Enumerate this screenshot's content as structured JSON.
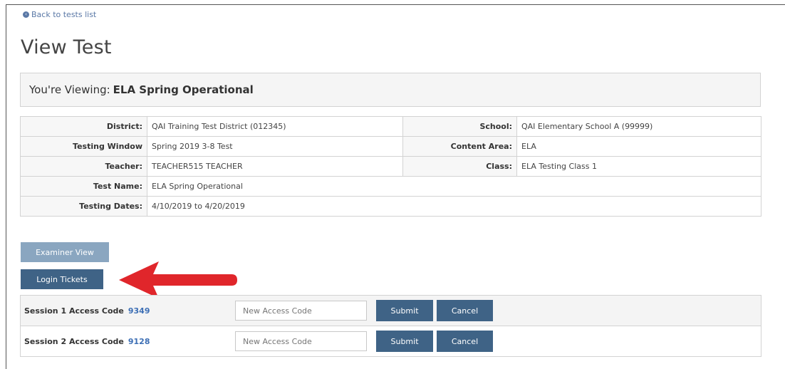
{
  "nav": {
    "back_label": "Back to tests list"
  },
  "page": {
    "title": "View Test"
  },
  "viewing": {
    "label": "You're Viewing:",
    "value": "ELA Spring Operational"
  },
  "info": {
    "district_label": "District:",
    "district_value": "QAI Training Test District (012345)",
    "school_label": "School:",
    "school_value": "QAI Elementary School A (99999)",
    "window_label": "Testing Window",
    "window_value": "Spring 2019 3-8 Test",
    "content_label": "Content Area:",
    "content_value": "ELA",
    "teacher_label": "Teacher:",
    "teacher_value": "TEACHER515 TEACHER",
    "class_label": "Class:",
    "class_value": "ELA Testing Class 1",
    "testname_label": "Test Name:",
    "testname_value": "ELA Spring Operational",
    "dates_label": "Testing Dates:",
    "dates_value": "4/10/2019 to 4/20/2019"
  },
  "buttons": {
    "examiner_view": "Examiner View",
    "login_tickets": "Login Tickets"
  },
  "sessions": [
    {
      "label": "Session 1 Access Code",
      "code": "9349",
      "placeholder": "New Access Code",
      "submit": "Submit",
      "cancel": "Cancel"
    },
    {
      "label": "Session 2 Access Code",
      "code": "9128",
      "placeholder": "New Access Code",
      "submit": "Submit",
      "cancel": "Cancel"
    }
  ],
  "colors": {
    "primary_button": "#3f6386",
    "disabled_button": "#8aa6c0",
    "arrow": "#e0262b",
    "link": "#5a78a6"
  },
  "icons": {
    "back": "back-arrow-circle-icon",
    "annotation": "red-arrow-icon"
  }
}
